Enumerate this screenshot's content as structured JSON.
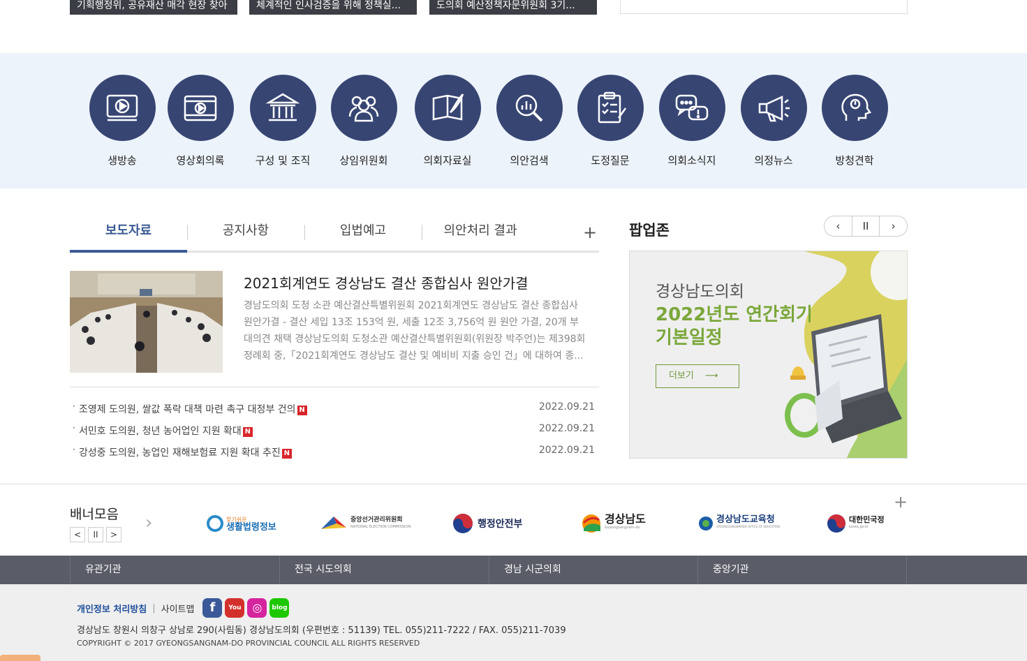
{
  "top_news": [
    "기획행정위, 공유재산 매각 현장 찾아",
    "체계적인 인사검증을 위해 정책실...",
    "도의회 예산정책자문위원회 3기..."
  ],
  "quick_menu": [
    {
      "label": "생방송",
      "icon": "live-tv-icon"
    },
    {
      "label": "영상회의록",
      "icon": "video-film-icon"
    },
    {
      "label": "구성 및 조직",
      "icon": "building-icon"
    },
    {
      "label": "상임위원회",
      "icon": "people-group-icon"
    },
    {
      "label": "의회자료실",
      "icon": "book-feather-icon"
    },
    {
      "label": "의안검색",
      "icon": "magnifier-chart-icon"
    },
    {
      "label": "도정질문",
      "icon": "clipboard-checklist-icon"
    },
    {
      "label": "의회소식지",
      "icon": "speech-bubbles-icon"
    },
    {
      "label": "의정뉴스",
      "icon": "megaphone-icon"
    },
    {
      "label": "방청견학",
      "icon": "head-idea-icon"
    }
  ],
  "tabs": [
    "보도자료",
    "공지사항",
    "입법예고",
    "의안처리 결과"
  ],
  "tabs_more": "+",
  "feature": {
    "title": "2021회계연도 경상남도 결산 종합심사 원안가결",
    "desc": "경남도의회 도청 소관 예산결산특별위원회 2021회계연도 경상남도 결산 종합심사 원안가결 - 결산 세입 13조 153억 원, 세출 12조 3,756억 원 원안 가결, 20개 부대의견 채택  경상남도의회 도청소관 예산결산특별위원회(위원장 박주언)는 제398회 정례회 중,「2021회계연도 경상남도 결산 및 예비비 지출 승인 건」에 대하여 종..."
  },
  "news": [
    {
      "title": "조영제 도의원, 쌀값 폭락 대책 마련 촉구 대정부 건의",
      "date": "2022.09.21",
      "badge": "N"
    },
    {
      "title": "서민호 도의원, 청년 농어업인 지원 확대",
      "date": "2022.09.21",
      "badge": "N"
    },
    {
      "title": "강성중 도의원, 농업인 재해보험료 지원 확대 추진",
      "date": "2022.09.21",
      "badge": "N"
    }
  ],
  "popup": {
    "title": "팝업존",
    "ctrl": {
      "prev": "‹",
      "pause": "II",
      "next": "›"
    },
    "banner_sub": "경상남도의회",
    "banner_main": "2022년도 연간회기 기본일정",
    "banner_btn": "더보기"
  },
  "banners": {
    "title": "배너모음",
    "more": "+",
    "ctrl": {
      "prev": "<",
      "pause": "II",
      "next": ">"
    },
    "logos": [
      {
        "name": "찾기쉬운 생활법령정보",
        "top": "찾기쉬운",
        "main": "생활법령정보"
      },
      {
        "name": "중앙선거관리위원회",
        "main": "중앙선거관리위원회",
        "sub": "NATIONAL ELECTION COMMISSION"
      },
      {
        "name": "행정안전부",
        "main": "행정안전부"
      },
      {
        "name": "경상남도",
        "main": "경상남도",
        "sub": "Gyeongsangnam-do"
      },
      {
        "name": "경상남도교육청",
        "main": "경상남도교육청",
        "sub": "GYEONGSANGNAMDO OFFICE OF EDUCATION"
      },
      {
        "name": "대한민국정부",
        "main": "대한민국정",
        "sub": "korea.go.kr"
      }
    ]
  },
  "footer_nav": [
    "유관기관",
    "전국 시도의회",
    "경남 시군의회",
    "중앙기관"
  ],
  "footer": {
    "privacy": "개인정보 처리방침",
    "sitemap": "사이트맵",
    "sns": [
      {
        "name": "facebook",
        "glyph": "f",
        "color": "#3b5998"
      },
      {
        "name": "youtube",
        "glyph": "You",
        "color": "#d4302b"
      },
      {
        "name": "instagram",
        "glyph": "◎",
        "color": "#d6249f"
      },
      {
        "name": "blog",
        "glyph": "blog",
        "color": "#1ec800"
      }
    ],
    "address": "경상남도 창원시 의창구 상남로 290(사림동) 경상남도의회 (우편번호 : 51139) TEL. 055)211-7222 / FAX. 055)211-7039",
    "copyright": "COPYRIGHT © 2017 GYEONGSANGNAM-DO PROVINCIAL COUNCIL ALL RIGHTS RESERVED"
  },
  "colors": {
    "navy": "#374573",
    "accent": "#3a5a93",
    "green": "#7aa73a",
    "footer_nav": "#5a5d68"
  }
}
